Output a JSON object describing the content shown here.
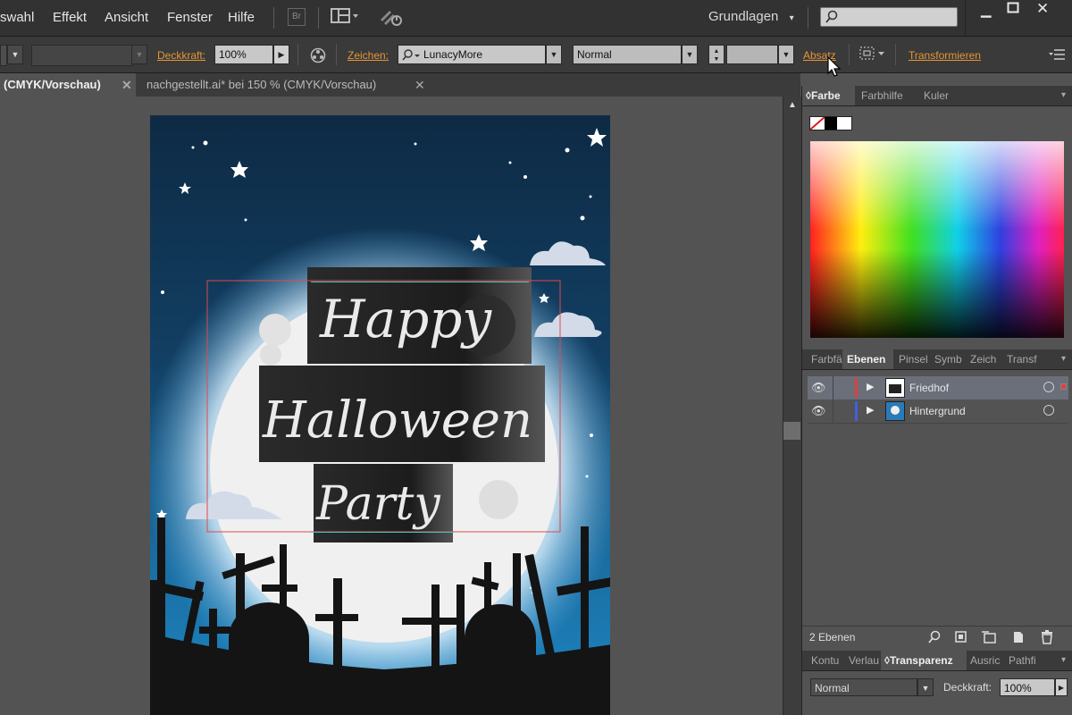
{
  "menubar": {
    "items": [
      "swahl",
      "Effekt",
      "Ansicht",
      "Fenster",
      "Hilfe"
    ],
    "bridge_label": "Br",
    "workspace": "Grundlagen"
  },
  "controlbar": {
    "opacity_label": "Deckkraft:",
    "opacity_value": "100%",
    "char_label": "Zeichen:",
    "font_value": "LunacyMore",
    "style_value": "Normal",
    "paragraph_label": "Absatz",
    "transform_label": "Transformieren"
  },
  "tabs": [
    {
      "label": "(CMYK/Vorschau)",
      "active": true
    },
    {
      "label": "nachgestellt.ai* bei 150 % (CMYK/Vorschau)",
      "active": false
    }
  ],
  "artwork": {
    "line1": "Happy",
    "line2": "Halloween",
    "line3": "Party"
  },
  "color_panel": {
    "tabs": [
      "Farbe",
      "Farbhilfe",
      "Kuler"
    ]
  },
  "layers_panel": {
    "tabs": [
      "Farbfä",
      "Ebenen",
      "Pinsel",
      "Symb",
      "Zeich",
      "Transf"
    ],
    "layers": [
      {
        "name": "Friedhof",
        "color": "#e04040",
        "selected": true
      },
      {
        "name": "Hintergrund",
        "color": "#4060e0",
        "selected": false
      }
    ],
    "count_label": "2 Ebenen"
  },
  "transparency_panel": {
    "tabs": [
      "Kontu",
      "Verlau",
      "Transparenz",
      "Ausric",
      "Pathfi"
    ],
    "blend_mode": "Normal",
    "opacity_label": "Deckkraft:",
    "opacity_value": "100%"
  }
}
